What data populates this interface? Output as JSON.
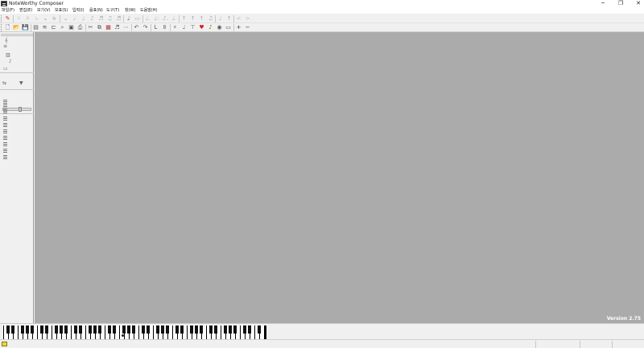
{
  "window": {
    "title": "NoteWorthy Composer",
    "minimize_glyph": "─",
    "maximize_glyph": "❐",
    "close_glyph": "✕"
  },
  "menu": [
    {
      "label": "파일(F)"
    },
    {
      "label": "편집(E)"
    },
    {
      "label": "보기(V)"
    },
    {
      "label": "보표(S)"
    },
    {
      "label": "입력(I)"
    },
    {
      "label": "음표(N)"
    },
    {
      "label": "도구(T)"
    },
    {
      "label": "창(W)"
    },
    {
      "label": "도움말(H)"
    }
  ],
  "toolbar_top": {
    "icons": [
      "note-entry-icon",
      "sharp-icon",
      "natural-sharp-icon",
      "flat-icon",
      "double-sharp-icon",
      "double-flat-icon",
      "whole-note-icon",
      "half-note-icon",
      "quarter-note-icon",
      "eighth-note-icon",
      "sixteenth-note-icon",
      "thirtysecond-note-icon",
      "sixtyfourth-note-icon",
      "grace-note-icon",
      "rest-icon",
      "dotted-icon",
      "double-dotted-icon",
      "triplet-icon",
      "stem-up-icon",
      "stem-down-icon",
      "tie-icon",
      "slur-icon",
      "beam-icon",
      "crescendo-icon",
      "decrescendo-icon"
    ]
  },
  "toolbar_bottom": {
    "icons": [
      "new-file-icon",
      "open-file-icon",
      "save-file-icon",
      "print-preview-icon",
      "print-icon",
      "cut-icon",
      "copy-icon",
      "paste-icon",
      "undo-icon",
      "redo-icon",
      "clef-icon",
      "key-signature-icon",
      "time-signature-icon",
      "tempo-icon",
      "dynamic-icon",
      "instrument-icon",
      "audio-icon",
      "play-icon",
      "stop-icon",
      "zoom-in-icon",
      "zoom-out-icon"
    ],
    "zoom_in_glyph": "+",
    "zoom_out_glyph": "−"
  },
  "workspace": {
    "version_label": "Version 2.75"
  },
  "statusbar": {
    "left_text": "",
    "right_text": ""
  },
  "colors": {
    "workspace_bg": "#ababab",
    "chrome_bg": "#f0f0f0",
    "version_text": "#ffffff"
  }
}
